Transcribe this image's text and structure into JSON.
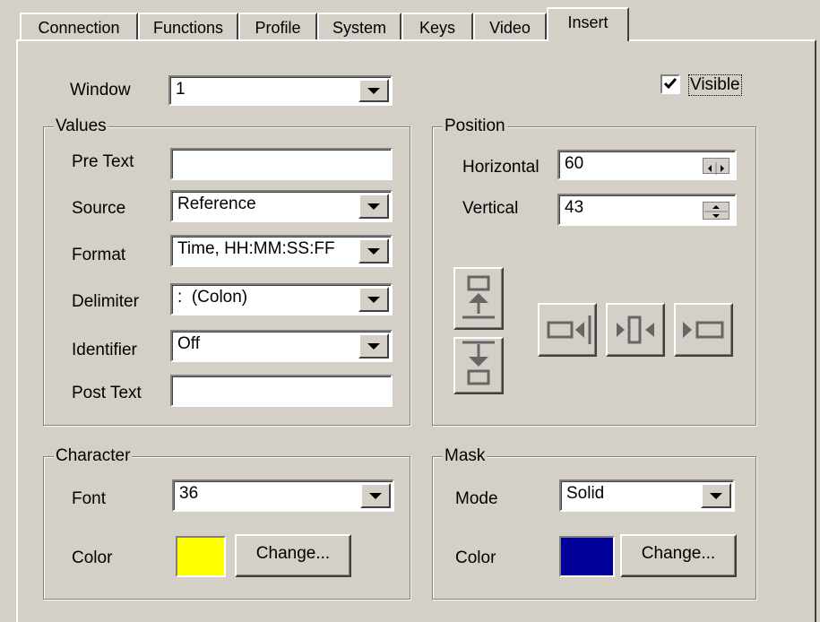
{
  "tabs": [
    {
      "label": "Connection"
    },
    {
      "label": "Functions"
    },
    {
      "label": "Profile"
    },
    {
      "label": "System"
    },
    {
      "label": "Keys"
    },
    {
      "label": "Video"
    },
    {
      "label": "Insert",
      "active": true
    }
  ],
  "window": {
    "label": "Window",
    "value": "1"
  },
  "visible": {
    "label": "Visible",
    "checked": true
  },
  "values_group": {
    "title": "Values",
    "pre_text": {
      "label": "Pre Text",
      "value": ""
    },
    "source": {
      "label": "Source",
      "value": "Reference"
    },
    "format": {
      "label": "Format",
      "value": "Time, HH:MM:SS:FF"
    },
    "delimiter": {
      "label": "Delimiter",
      "value": ":  (Colon)"
    },
    "identifier": {
      "label": "Identifier",
      "value": "Off"
    },
    "post_text": {
      "label": "Post Text",
      "value": ""
    }
  },
  "position_group": {
    "title": "Position",
    "horizontal": {
      "label": "Horizontal",
      "value": "60"
    },
    "vertical": {
      "label": "Vertical",
      "value": "43"
    }
  },
  "character_group": {
    "title": "Character",
    "font": {
      "label": "Font",
      "value": "36"
    },
    "color": {
      "label": "Color",
      "swatch": "#ffff00"
    },
    "change_label": "Change..."
  },
  "mask_group": {
    "title": "Mask",
    "mode": {
      "label": "Mode",
      "value": "Solid"
    },
    "color": {
      "label": "Color",
      "swatch": "#000099"
    },
    "change_label": "Change..."
  },
  "align_icons": [
    "align-top-icon",
    "align-bottom-icon",
    "align-right-icon",
    "align-center-horizontal-icon",
    "align-left-icon"
  ]
}
